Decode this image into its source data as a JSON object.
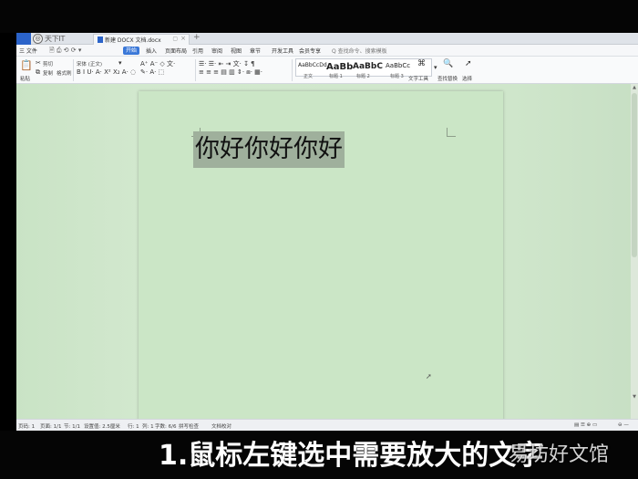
{
  "titlebar": {
    "logo_text": "天下IT",
    "doc_tab_name": "新建 DOCX 文档.docx",
    "new_tab": "+"
  },
  "menubar": {
    "file": "三 文件",
    "start": "开始",
    "items": [
      "插入",
      "页面布局",
      "引用",
      "审阅",
      "视图",
      "章节",
      "开发工具",
      "会员专享"
    ],
    "search_placeholder": "Q 查找命令、搜索模板"
  },
  "ribbon": {
    "paste": "粘贴",
    "cut": "剪切",
    "copy": "复制",
    "format_painter": "格式刷",
    "font_name": "宋体 (正文)",
    "styles": [
      {
        "preview": "AaBbCcDd",
        "name": "正文"
      },
      {
        "preview": "AaBb",
        "name": "标题 1"
      },
      {
        "preview": "AaBbC",
        "name": "标题 2"
      },
      {
        "preview": "AaBbCc",
        "name": "标题 3"
      }
    ],
    "text_tools": "文字工具",
    "find_replace": "查找替换",
    "select": "选择"
  },
  "document": {
    "selected_text": "你好你好你好"
  },
  "statusbar": {
    "page": "页码: 1",
    "pages": "页面: 1/1",
    "section": "节: 1/1",
    "position": "设置值: 2.5厘米",
    "line": "行: 1",
    "column": "列: 1",
    "word_count": "字数: 6/6",
    "spell_check": "拼写检查",
    "doc_check": "文档校对"
  },
  "caption": {
    "text": "1.鼠标左键选中需要放大的文字",
    "watermark": "易坊好文馆"
  }
}
